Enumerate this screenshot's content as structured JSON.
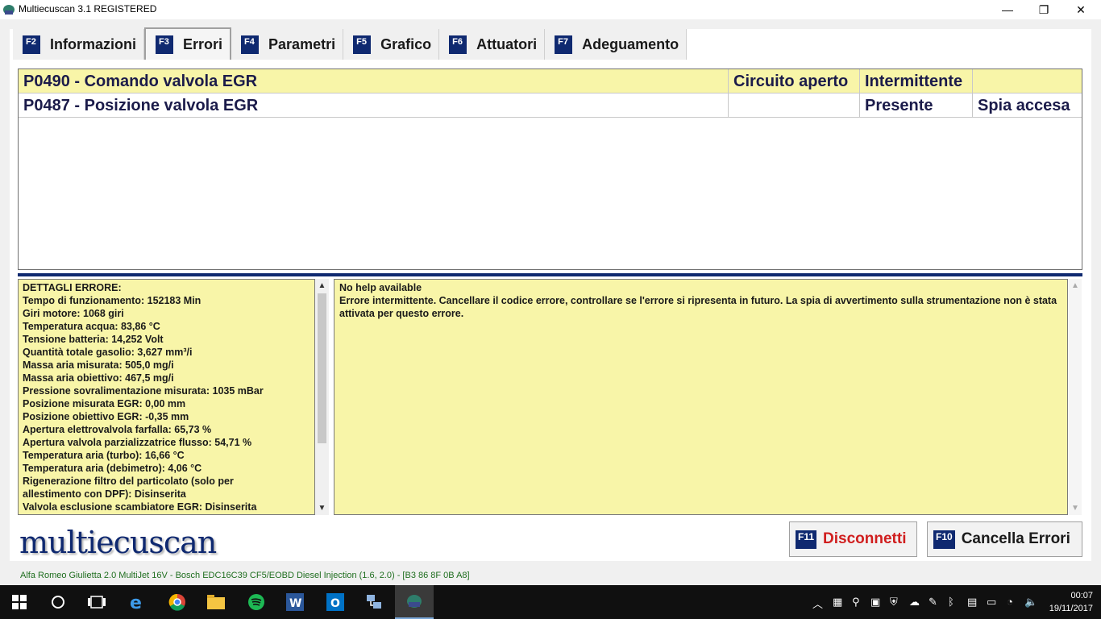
{
  "window": {
    "title": "Multiecuscan 3.1 REGISTERED",
    "minimize_glyph": "—",
    "restore_glyph": "❐",
    "close_glyph": "✕"
  },
  "tabs": [
    {
      "key": "F2",
      "label": "Informazioni"
    },
    {
      "key": "F3",
      "label": "Errori",
      "active": true
    },
    {
      "key": "F4",
      "label": "Parametri"
    },
    {
      "key": "F5",
      "label": "Grafico"
    },
    {
      "key": "F6",
      "label": "Attuatori"
    },
    {
      "key": "F7",
      "label": "Adeguamento"
    }
  ],
  "errors": [
    {
      "code": "P0490 - Comando valvola EGR",
      "type": "Circuito aperto",
      "state": "Intermittente",
      "lamp": ""
    },
    {
      "code": "P0487 - Posizione valvola EGR",
      "type": "",
      "state": "Presente",
      "lamp": "Spia accesa"
    }
  ],
  "details": [
    "DETTAGLI ERRORE:",
    "Tempo di funzionamento: 152183 Min",
    "Giri motore: 1068 giri",
    "Temperatura acqua: 83,86 °C",
    "Tensione batteria: 14,252 Volt",
    "Quantità totale gasolio: 3,627 mm³/i",
    "Massa aria misurata: 505,0 mg/i",
    "Massa aria obiettivo: 467,5 mg/i",
    "Pressione sovralimentazione misurata: 1035 mBar",
    "Posizione misurata EGR: 0,00 mm",
    "Posizione obiettivo EGR: -0,35 mm",
    "Apertura elettrovalvola farfalla: 65,73 %",
    "Apertura valvola parzializzatrice flusso: 54,71 %",
    "Temperatura aria (turbo): 16,66 °C",
    "Temperatura aria (debimetro): 4,06 °C",
    "Rigenerazione filtro del particolato (solo per",
    "allestimento con DPF): Disinserita",
    "Valvola esclusione scambiatore EGR: Disinserita"
  ],
  "help": {
    "title": "No help available",
    "text": "Errore intermittente. Cancellare il codice errore, controllare se l'errore si ripresenta in futuro. La spia di avvertimento sulla strumentazione non è stata attivata per questo errore."
  },
  "logo": "multiecuscan",
  "buttons": {
    "disconnect": {
      "key": "F11",
      "label": "Disconnetti",
      "color": "#d01e1e"
    },
    "clear": {
      "key": "F10",
      "label": "Cancella Errori",
      "color": "#1a1a1a"
    }
  },
  "status": "Alfa Romeo Giulietta 2.0 MultiJet 16V - Bosch EDC16C39 CF5/EOBD Diesel Injection (1.6, 2.0) - [B3 86 8F 0B A8]",
  "taskbar": {
    "time": "00:07",
    "date": "19/11/2017"
  },
  "colors": {
    "accent_navy": "#0f2970",
    "panel_yellow": "#f8f5a8",
    "status_green": "#1f6e1f"
  }
}
